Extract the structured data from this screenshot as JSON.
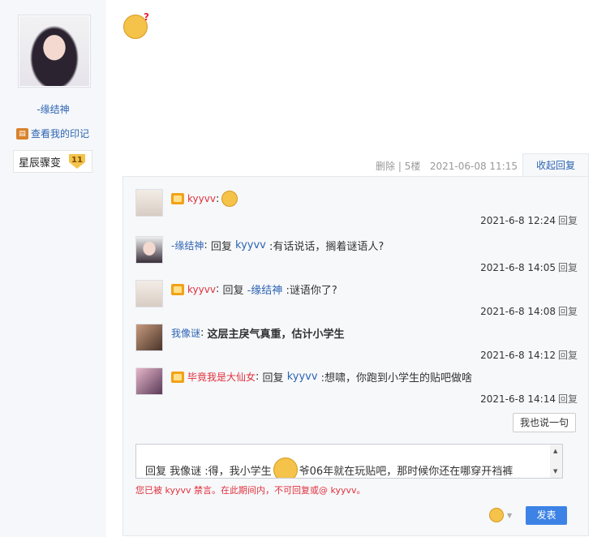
{
  "author": {
    "name": "-缘结神",
    "imprint_link": "查看我的印记",
    "badge_label": "星辰骤变",
    "badge_level": "11"
  },
  "post": {
    "delete_label": "删除",
    "separator": "|",
    "floor": "5楼",
    "datetime": "2021-06-08 11:15",
    "collapse_label": "收起回复"
  },
  "comments": [
    {
      "user": "kyyvv",
      "user_color": "red",
      "crown": true,
      "text": "",
      "emoji": "doubt-face",
      "time": "2021-6-8 12:24",
      "reply": "回复"
    },
    {
      "user": "-缘结神",
      "user_color": "blue",
      "crown": false,
      "prefix": "回复",
      "target": "kyyvv",
      "text": ":有话说话，搁着谜语人?",
      "time": "2021-6-8 14:05",
      "reply": "回复"
    },
    {
      "user": "kyyvv",
      "user_color": "red",
      "crown": true,
      "prefix": "回复",
      "target": "-缘结神",
      "text": ":谜语你了?",
      "time": "2021-6-8 14:08",
      "reply": "回复"
    },
    {
      "user": "我像谜",
      "user_color": "blue",
      "crown": false,
      "text": "这层主戾气真重，估计小学生",
      "time": "2021-6-8 14:12",
      "reply": "回复"
    },
    {
      "user": "毕竟我是大仙女",
      "user_color": "red",
      "crown": true,
      "prefix": "回复",
      "target": "kyyvv",
      "text": ":想啸，你跑到小学生的贴吧做啥",
      "time": "2021-6-8 14:14",
      "reply": "回复"
    }
  ],
  "say_button": "我也说一句",
  "editor": {
    "text_before": "回复 我像谜 :得，我小学生",
    "text_after": "爷06年就在玩贴吧，那时候你还在哪穿开裆裤"
  },
  "ban_notice": "您已被 kyyvv 禁言。在此期间内，不可回复或@ kyyvv。",
  "publish_button": "发表",
  "colors": {
    "link": "#2d64b3",
    "red_user": "#e0303c",
    "publish": "#3d83e6"
  }
}
